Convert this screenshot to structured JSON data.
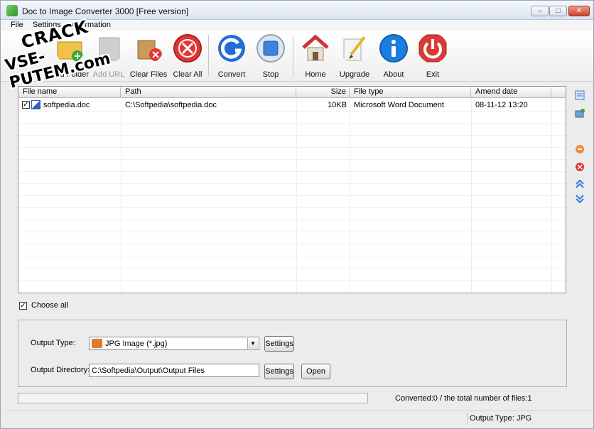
{
  "window": {
    "title": "Doc to Image Converter 3000 [Free version]",
    "minimize_label": "–",
    "maximize_label": "□",
    "close_label": "✕"
  },
  "watermark": {
    "line1": "CRACK",
    "line2": "VSE-PUTEM.com"
  },
  "menu": [
    "File",
    "Settings",
    "Information"
  ],
  "toolbar": {
    "items": [
      {
        "label": "Add Folder",
        "icon": "add-folder-icon",
        "enabled": true
      },
      {
        "label": "Add URL",
        "icon": "add-url-icon",
        "enabled": false
      },
      {
        "label": "Clear Files",
        "icon": "clear-files-icon",
        "enabled": true
      },
      {
        "label": "Clear All",
        "icon": "clear-all-icon",
        "enabled": true
      },
      {
        "label": "Convert",
        "icon": "convert-icon",
        "enabled": true
      },
      {
        "label": "Stop",
        "icon": "stop-icon",
        "enabled": true
      },
      {
        "label": "Home",
        "icon": "home-icon",
        "enabled": true
      },
      {
        "label": "Upgrade",
        "icon": "upgrade-icon",
        "enabled": true
      },
      {
        "label": "About",
        "icon": "about-icon",
        "enabled": true
      },
      {
        "label": "Exit",
        "icon": "exit-icon",
        "enabled": true
      }
    ]
  },
  "file_list": {
    "columns": [
      "File name",
      "Path",
      "Size",
      "File type",
      "Amend date"
    ],
    "rows": [
      {
        "checked": true,
        "file_name": "softpedia.doc",
        "path": "C:\\Softpedia\\softpedia.doc",
        "size": "10KB",
        "file_type": "Microsoft Word Document",
        "amend_date": "08-11-12 13:20"
      }
    ]
  },
  "choose_all": {
    "label": "Choose all",
    "checked": true
  },
  "output": {
    "type_label": "Output Type:",
    "type_value": "JPG Image (*.jpg)",
    "directory_label": "Output Directory:",
    "directory_value": "C:\\Softpedia\\Output\\Output Files",
    "settings_label": "Settings",
    "open_label": "Open"
  },
  "progress": {
    "fraction": 0
  },
  "status": {
    "converted_text": "Converted:0  /  the total number of files:1",
    "output_type_text": "Output Type: JPG"
  },
  "side_icons": [
    "list-view-icon",
    "add-folder-small-icon",
    "remove-icon",
    "delete-icon",
    "move-up-icon",
    "move-down-icon"
  ],
  "colors": {
    "accent_green": "#4dbb3a",
    "convert_blue": "#1f6fd6",
    "clear_all_red": "#e23535",
    "exit_red": "#d83b36",
    "about_blue": "#1b7fe0"
  }
}
